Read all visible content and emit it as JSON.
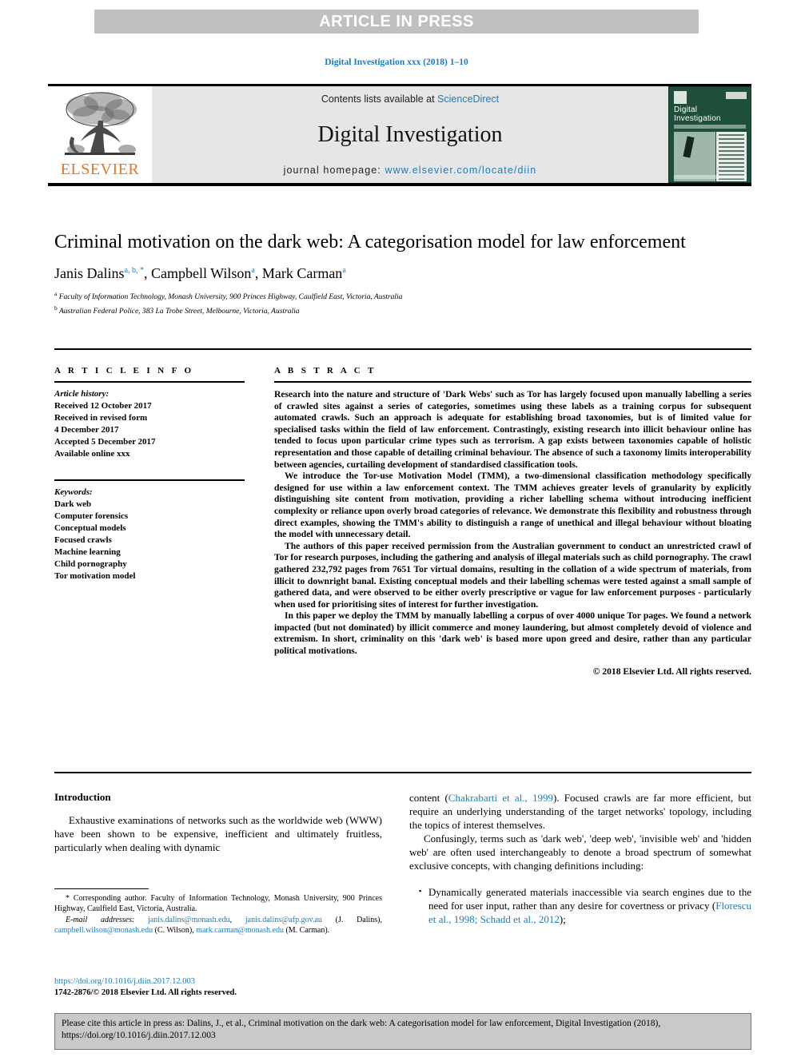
{
  "banner": {
    "text": "ARTICLE IN PRESS"
  },
  "running_head": "Digital Investigation xxx (2018) 1–10",
  "masthead": {
    "publisher_word": "ELSEVIER",
    "contents_prefix": "Contents lists available at ",
    "contents_link": "ScienceDirect",
    "journal_title": "Digital Investigation",
    "homepage_prefix": "journal homepage: ",
    "homepage_url": "www.elsevier.com/locate/diin",
    "cover": {
      "title_line1": "Digital",
      "title_line2": "Investigation"
    }
  },
  "article": {
    "title": "Criminal motivation on the dark web: A categorisation model for law enforcement",
    "authors": [
      {
        "name": "Janis Dalins",
        "marks": "a, b, *"
      },
      {
        "name": "Campbell Wilson",
        "marks": "a"
      },
      {
        "name": "Mark Carman",
        "marks": "a"
      }
    ],
    "affiliations": [
      {
        "mark": "a",
        "text": "Faculty of Information Technology, Monash University, 900 Princes Highway, Caulfield East, Victoria, Australia"
      },
      {
        "mark": "b",
        "text": "Australian Federal Police, 383 La Trobe Street, Melbourne, Victoria, Australia"
      }
    ]
  },
  "article_info": {
    "heading": "A R T I C L E   I N F O",
    "history_heading": "Article history:",
    "history_lines": [
      "Received 12 October 2017",
      "Received in revised form",
      "4 December 2017",
      "Accepted 5 December 2017",
      "Available online xxx"
    ],
    "keywords_heading": "Keywords:",
    "keywords": [
      "Dark web",
      "Computer forensics",
      "Conceptual models",
      "Focused crawls",
      "Machine learning",
      "Child pornography",
      "Tor motivation model"
    ]
  },
  "abstract": {
    "heading": "A B S T R A C T",
    "paragraphs": [
      "Research into the nature and structure of 'Dark Webs' such as Tor has largely focused upon manually labelling a series of crawled sites against a series of categories, sometimes using these labels as a training corpus for subsequent automated crawls. Such an approach is adequate for establishing broad taxonomies, but is of limited value for specialised tasks within the field of law enforcement. Contrastingly, existing research into illicit behaviour online has tended to focus upon particular crime types such as terrorism. A gap exists between taxonomies capable of holistic representation and those capable of detailing criminal behaviour. The absence of such a taxonomy limits interoperability between agencies, curtailing development of standardised classification tools.",
      "We introduce the Tor-use Motivation Model (TMM), a two-dimensional classification methodology specifically designed for use within a law enforcement context. The TMM achieves greater levels of granularity by explicitly distinguishing site content from motivation, providing a richer labelling schema without introducing inefficient complexity or reliance upon overly broad categories of relevance. We demonstrate this flexibility and robustness through direct examples, showing the TMM's ability to distinguish a range of unethical and illegal behaviour without bloating the model with unnecessary detail.",
      "The authors of this paper received permission from the Australian government to conduct an unrestricted crawl of Tor for research purposes, including the gathering and analysis of illegal materials such as child pornography. The crawl gathered 232,792 pages from 7651 Tor virtual domains, resulting in the collation of a wide spectrum of materials, from illicit to downright banal. Existing conceptual models and their labelling schemas were tested against a small sample of gathered data, and were observed to be either overly prescriptive or vague for law enforcement purposes - particularly when used for prioritising sites of interest for further investigation.",
      "In this paper we deploy the TMM by manually labelling a corpus of over 4000 unique Tor pages. We found a network impacted (but not dominated) by illicit commerce and money laundering, but almost completely devoid of violence and extremism. In short, criminality on this 'dark web' is based more upon greed and desire, rather than any particular political motivations."
    ],
    "copyright": "© 2018 Elsevier Ltd. All rights reserved."
  },
  "body": {
    "intro_heading": "Introduction",
    "left_paragraph": "Exhaustive examinations of networks such as the worldwide web (WWW) have been shown to be expensive, inefficient and ultimately fruitless, particularly when dealing with dynamic",
    "right_paragraph_1_pre": "content (",
    "right_paragraph_1_cite": "Chakrabarti et al., 1999",
    "right_paragraph_1_post": "). Focused crawls are far more efficient, but require an underlying understanding of the target networks' topology, including the topics of interest themselves.",
    "right_paragraph_2": "Confusingly, terms such as 'dark web', 'deep web', 'invisible web' and 'hidden web' are often used interchangeably to denote a broad spectrum of somewhat exclusive concepts, with changing definitions including:",
    "bullet_1_pre": "Dynamically generated materials inaccessible via search engines due to the need for user input, rather than any desire for covertness or privacy (",
    "bullet_1_cite": "Florescu et al., 1998; Schadd et al., 2012",
    "bullet_1_post": ");"
  },
  "footnote": {
    "corresponding": "* Corresponding author. Faculty of Information Technology, Monash University, 900 Princes Highway, Caulfield East, Victoria, Australia.",
    "emails_label": "E-mail addresses:",
    "emails": [
      {
        "address": "janis.dalins@monash.edu",
        "sep": ", "
      },
      {
        "address": "janis.dalins@afp.gov.au",
        "sep": " (J. Dalins), "
      },
      {
        "address": "campbell.wilson@monash.edu",
        "sep": " (C. Wilson), "
      },
      {
        "address": "mark.carman@monash.edu",
        "sep": " (M. Carman)."
      }
    ],
    "doi": "https://doi.org/10.1016/j.diin.2017.12.003",
    "issn": "1742-2876/© 2018 Elsevier Ltd. All rights reserved."
  },
  "cite_box": {
    "text": "Please cite this article in press as: Dalins, J., et al., Criminal motivation on the dark web: A categorisation model for law enforcement, Digital Investigation (2018), https://doi.org/10.1016/j.diin.2017.12.003"
  },
  "colors": {
    "link": "#1f7bb6",
    "banner_bg": "#c0c0c0",
    "journal_box_bg": "#e6e6e6",
    "elsevier_orange": "#e87722",
    "cover_green": "#1d4f3a",
    "cite_box_bg": "#c9c9c9"
  }
}
